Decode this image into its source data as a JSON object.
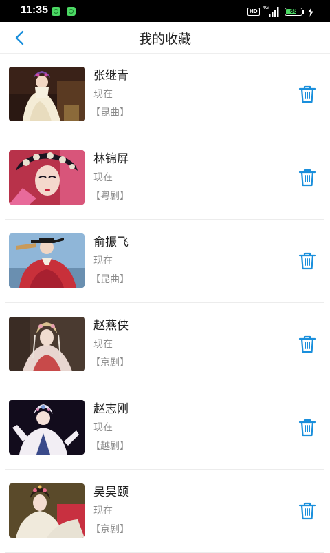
{
  "status_bar": {
    "time": "11:35",
    "hd": "HD",
    "network": "4G",
    "battery": "66",
    "battery_level": 0.66
  },
  "header": {
    "title": "我的收藏",
    "back_icon": "chevron-left-icon"
  },
  "colors": {
    "accent": "#1a8fdc",
    "text_primary": "#222222",
    "text_secondary": "#8a8a8a",
    "status_bar_bg": "#000000"
  },
  "favorites": [
    {
      "name": "张继青",
      "time": "现在",
      "genre": "【昆曲】",
      "image": "opera-performer-photo",
      "delete_icon": "trash-icon"
    },
    {
      "name": "林锦屏",
      "time": "现在",
      "genre": "【粤剧】",
      "image": "opera-performer-photo",
      "delete_icon": "trash-icon"
    },
    {
      "name": "俞振飞",
      "time": "现在",
      "genre": "【昆曲】",
      "image": "opera-performer-photo",
      "delete_icon": "trash-icon"
    },
    {
      "name": "赵燕侠",
      "time": "现在",
      "genre": "【京剧】",
      "image": "opera-performer-photo",
      "delete_icon": "trash-icon"
    },
    {
      "name": "赵志刚",
      "time": "现在",
      "genre": "【越剧】",
      "image": "opera-performer-photo",
      "delete_icon": "trash-icon"
    },
    {
      "name": "吴昊颐",
      "time": "现在",
      "genre": "【京剧】",
      "image": "opera-performer-photo",
      "delete_icon": "trash-icon"
    }
  ]
}
